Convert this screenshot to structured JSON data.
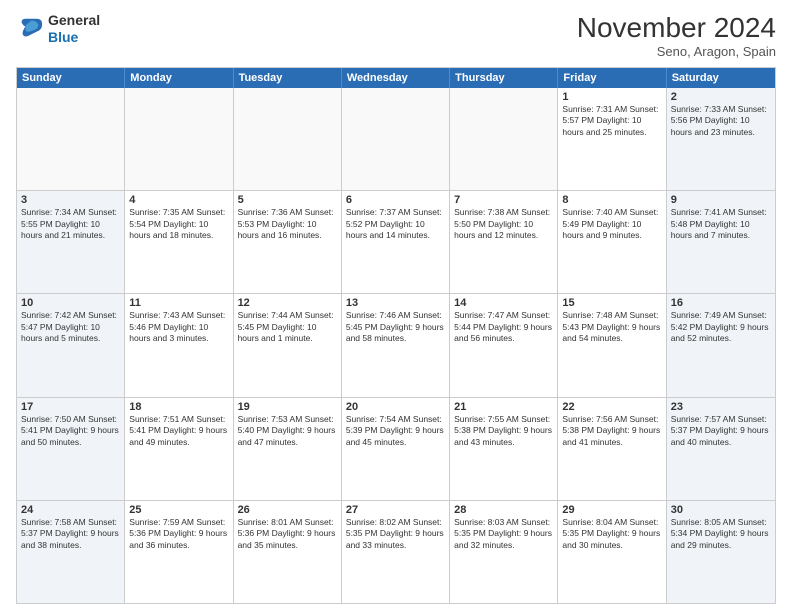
{
  "logo": {
    "general": "General",
    "blue": "Blue"
  },
  "header": {
    "month": "November 2024",
    "location": "Seno, Aragon, Spain"
  },
  "days": [
    "Sunday",
    "Monday",
    "Tuesday",
    "Wednesday",
    "Thursday",
    "Friday",
    "Saturday"
  ],
  "weeks": [
    [
      {
        "day": "",
        "info": "",
        "empty": true
      },
      {
        "day": "",
        "info": "",
        "empty": true
      },
      {
        "day": "",
        "info": "",
        "empty": true
      },
      {
        "day": "",
        "info": "",
        "empty": true
      },
      {
        "day": "",
        "info": "",
        "empty": true
      },
      {
        "day": "1",
        "info": "Sunrise: 7:31 AM\nSunset: 5:57 PM\nDaylight: 10 hours and 25 minutes."
      },
      {
        "day": "2",
        "info": "Sunrise: 7:33 AM\nSunset: 5:56 PM\nDaylight: 10 hours and 23 minutes."
      }
    ],
    [
      {
        "day": "3",
        "info": "Sunrise: 7:34 AM\nSunset: 5:55 PM\nDaylight: 10 hours and 21 minutes."
      },
      {
        "day": "4",
        "info": "Sunrise: 7:35 AM\nSunset: 5:54 PM\nDaylight: 10 hours and 18 minutes."
      },
      {
        "day": "5",
        "info": "Sunrise: 7:36 AM\nSunset: 5:53 PM\nDaylight: 10 hours and 16 minutes."
      },
      {
        "day": "6",
        "info": "Sunrise: 7:37 AM\nSunset: 5:52 PM\nDaylight: 10 hours and 14 minutes."
      },
      {
        "day": "7",
        "info": "Sunrise: 7:38 AM\nSunset: 5:50 PM\nDaylight: 10 hours and 12 minutes."
      },
      {
        "day": "8",
        "info": "Sunrise: 7:40 AM\nSunset: 5:49 PM\nDaylight: 10 hours and 9 minutes."
      },
      {
        "day": "9",
        "info": "Sunrise: 7:41 AM\nSunset: 5:48 PM\nDaylight: 10 hours and 7 minutes."
      }
    ],
    [
      {
        "day": "10",
        "info": "Sunrise: 7:42 AM\nSunset: 5:47 PM\nDaylight: 10 hours and 5 minutes."
      },
      {
        "day": "11",
        "info": "Sunrise: 7:43 AM\nSunset: 5:46 PM\nDaylight: 10 hours and 3 minutes."
      },
      {
        "day": "12",
        "info": "Sunrise: 7:44 AM\nSunset: 5:45 PM\nDaylight: 10 hours and 1 minute."
      },
      {
        "day": "13",
        "info": "Sunrise: 7:46 AM\nSunset: 5:45 PM\nDaylight: 9 hours and 58 minutes."
      },
      {
        "day": "14",
        "info": "Sunrise: 7:47 AM\nSunset: 5:44 PM\nDaylight: 9 hours and 56 minutes."
      },
      {
        "day": "15",
        "info": "Sunrise: 7:48 AM\nSunset: 5:43 PM\nDaylight: 9 hours and 54 minutes."
      },
      {
        "day": "16",
        "info": "Sunrise: 7:49 AM\nSunset: 5:42 PM\nDaylight: 9 hours and 52 minutes."
      }
    ],
    [
      {
        "day": "17",
        "info": "Sunrise: 7:50 AM\nSunset: 5:41 PM\nDaylight: 9 hours and 50 minutes."
      },
      {
        "day": "18",
        "info": "Sunrise: 7:51 AM\nSunset: 5:41 PM\nDaylight: 9 hours and 49 minutes."
      },
      {
        "day": "19",
        "info": "Sunrise: 7:53 AM\nSunset: 5:40 PM\nDaylight: 9 hours and 47 minutes."
      },
      {
        "day": "20",
        "info": "Sunrise: 7:54 AM\nSunset: 5:39 PM\nDaylight: 9 hours and 45 minutes."
      },
      {
        "day": "21",
        "info": "Sunrise: 7:55 AM\nSunset: 5:38 PM\nDaylight: 9 hours and 43 minutes."
      },
      {
        "day": "22",
        "info": "Sunrise: 7:56 AM\nSunset: 5:38 PM\nDaylight: 9 hours and 41 minutes."
      },
      {
        "day": "23",
        "info": "Sunrise: 7:57 AM\nSunset: 5:37 PM\nDaylight: 9 hours and 40 minutes."
      }
    ],
    [
      {
        "day": "24",
        "info": "Sunrise: 7:58 AM\nSunset: 5:37 PM\nDaylight: 9 hours and 38 minutes."
      },
      {
        "day": "25",
        "info": "Sunrise: 7:59 AM\nSunset: 5:36 PM\nDaylight: 9 hours and 36 minutes."
      },
      {
        "day": "26",
        "info": "Sunrise: 8:01 AM\nSunset: 5:36 PM\nDaylight: 9 hours and 35 minutes."
      },
      {
        "day": "27",
        "info": "Sunrise: 8:02 AM\nSunset: 5:35 PM\nDaylight: 9 hours and 33 minutes."
      },
      {
        "day": "28",
        "info": "Sunrise: 8:03 AM\nSunset: 5:35 PM\nDaylight: 9 hours and 32 minutes."
      },
      {
        "day": "29",
        "info": "Sunrise: 8:04 AM\nSunset: 5:35 PM\nDaylight: 9 hours and 30 minutes."
      },
      {
        "day": "30",
        "info": "Sunrise: 8:05 AM\nSunset: 5:34 PM\nDaylight: 9 hours and 29 minutes."
      }
    ]
  ]
}
